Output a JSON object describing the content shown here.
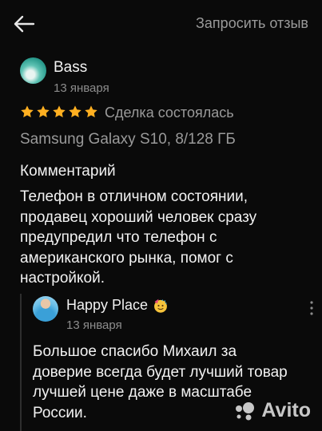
{
  "header": {
    "request_review": "Запросить отзыв"
  },
  "review": {
    "author": "Bass",
    "date": "13 января",
    "rating": 5,
    "status": "Сделка состоялась",
    "device": "Samsung Galaxy S10, 8/128 ГБ",
    "comment_heading": "Комментарий",
    "comment": "Телефон в отличном состоянии, продавец хороший человек сразу предупредил что телефон с американского рынка, помог с настройкой."
  },
  "reply": {
    "author": "Happy Place",
    "date": "13 января",
    "text": "Большое спасибо Михаил за доверие всегда будет лучший товар лучшей цене даже в масштабе России."
  },
  "watermark": {
    "text": "Avito"
  },
  "colors": {
    "background": "#0a0a0a",
    "star": "#ffb021",
    "muted": "#8c8c8c"
  },
  "icons": {
    "back": "arrow-left-icon",
    "star": "star-icon",
    "emoji": "party-face-emoji-icon",
    "more": "more-vertical-icon"
  }
}
